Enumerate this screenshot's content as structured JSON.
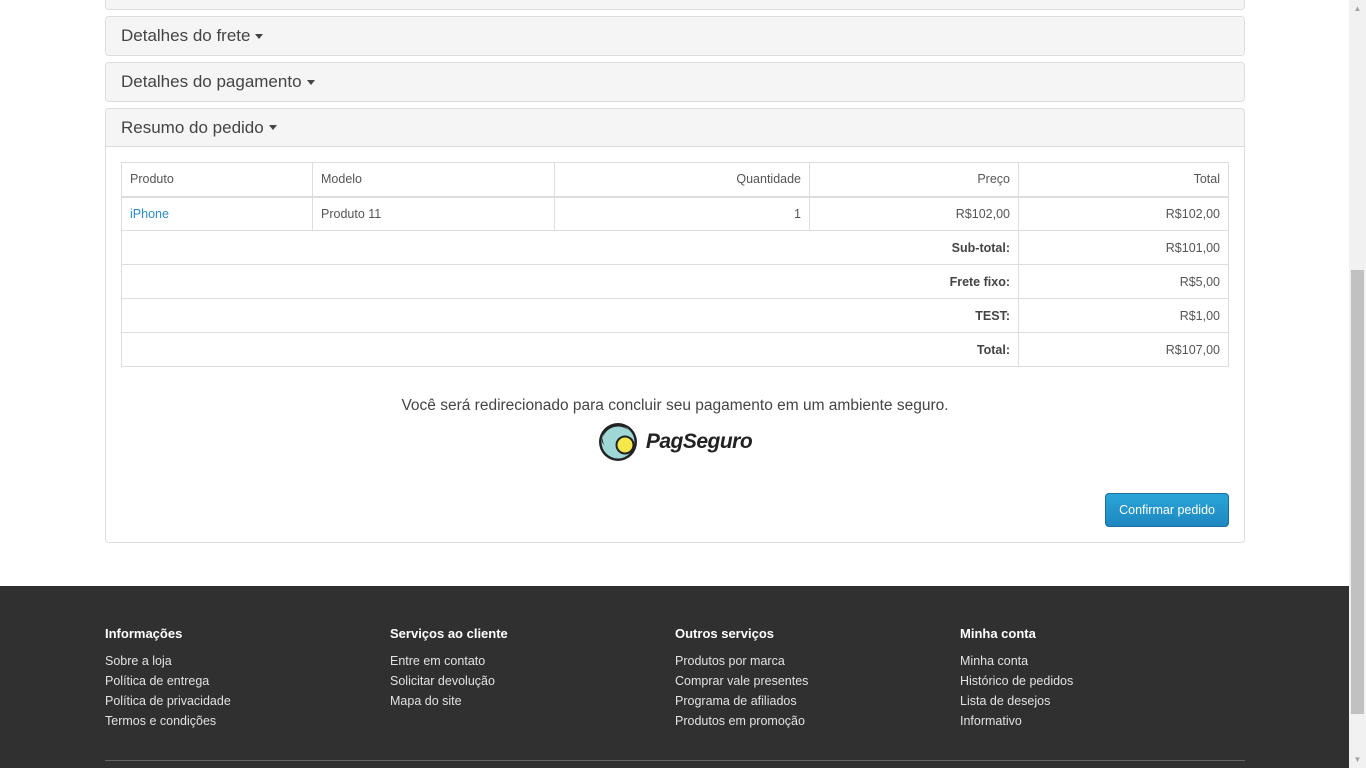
{
  "panels": {
    "shipping": {
      "label": "Detalhes do frete"
    },
    "payment": {
      "label": "Detalhes do pagamento"
    },
    "summary": {
      "label": "Resumo do pedido"
    }
  },
  "order_table": {
    "headers": [
      "Produto",
      "Modelo",
      "Quantidade",
      "Preço",
      "Total"
    ],
    "item": {
      "product": "iPhone",
      "model": "Produto 11",
      "quantity": "1",
      "price": "R$102,00",
      "total": "R$102,00"
    },
    "totals": [
      {
        "label": "Sub-total:",
        "value": "R$101,00"
      },
      {
        "label": "Frete fixo:",
        "value": "R$5,00"
      },
      {
        "label": "TEST:",
        "value": "R$1,00"
      },
      {
        "label": "Total:",
        "value": "R$107,00"
      }
    ]
  },
  "redirect_message": "Você será redirecionado para concluir seu pagamento em um ambiente seguro.",
  "logo": {
    "text": "PagSeguro",
    "icon": "pagseguro-logo-icon"
  },
  "confirm_button": "Confirmar pedido",
  "footer": {
    "columns": [
      {
        "title": "Informações",
        "links": [
          "Sobre a loja",
          "Política de entrega",
          "Política de privacidade",
          "Termos e condições"
        ]
      },
      {
        "title": "Serviços ao cliente",
        "links": [
          "Entre em contato",
          "Solicitar devolução",
          "Mapa do site"
        ]
      },
      {
        "title": "Outros serviços",
        "links": [
          "Produtos por marca",
          "Comprar vale presentes",
          "Programa de afiliados",
          "Produtos em promoção"
        ]
      },
      {
        "title": "Minha conta",
        "links": [
          "Minha conta",
          "Histórico de pedidos",
          "Lista de desejos",
          "Informativo"
        ]
      }
    ]
  },
  "colors": {
    "link": "#2a8cc7",
    "button": "#1e87bf",
    "footer_bg": "#303030"
  }
}
